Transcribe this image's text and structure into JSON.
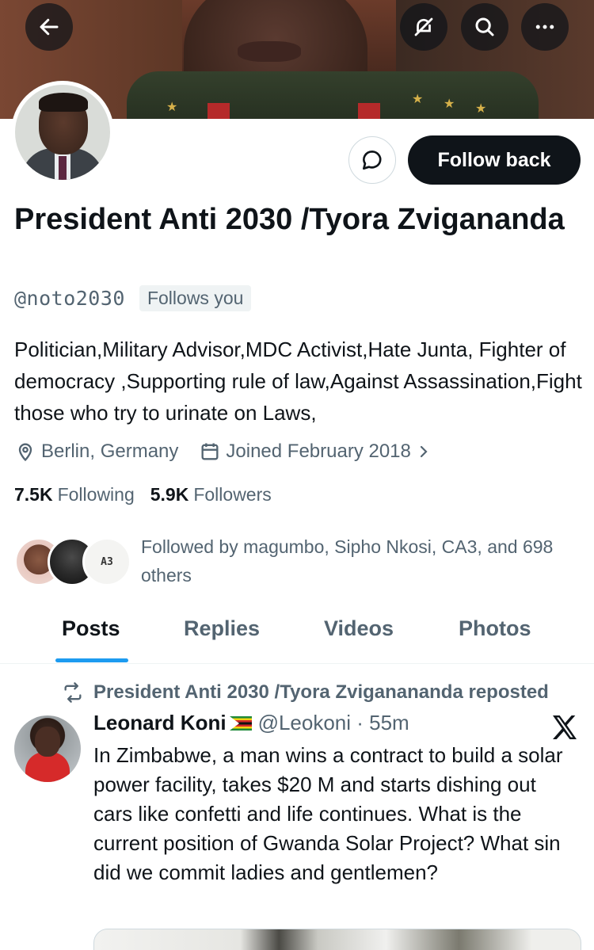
{
  "header": {
    "back_icon": "arrow-left-icon",
    "notifications_off_icon": "bell-slash-icon",
    "search_icon": "search-icon",
    "more_icon": "more-horizontal-icon"
  },
  "profile": {
    "name": "President Anti 2030 /Tyora Zvigananda",
    "handle": "@noto2030",
    "follows_you": "Follows you",
    "bio": "Politician,Military Advisor,MDC Activist,Hate Junta, Fighter of democracy ,Supporting rule of law,Against Assassination,Fight those who try to urinate on Laws,",
    "location": "Berlin, Germany",
    "joined": "Joined February 2018",
    "following_count": "7.5K",
    "following_label": "Following",
    "followers_count": "5.9K",
    "followers_label": "Followers",
    "followed_by": "Followed by magumbo, Sipho Nkosi, CA3, and 698 others",
    "mini_avatar_c_text": "A3"
  },
  "actions": {
    "message_icon": "message-bubble-icon",
    "follow_back_label": "Follow back"
  },
  "tabs": [
    {
      "label": "Posts",
      "active": true
    },
    {
      "label": "Replies",
      "active": false
    },
    {
      "label": "Videos",
      "active": false
    },
    {
      "label": "Photos",
      "active": false
    }
  ],
  "post": {
    "repost_text": "President Anti 2030 /Tyora Zviganananda reposted",
    "author": "Leonard Koni",
    "handle_time": "@Leokoni · 55m",
    "text": "In Zimbabwe, a man wins a contract to build a solar power facility, takes $20 M and starts dishing out cars like confetti and life continues. What is the current position of Gwanda Solar Project? What sin did we commit ladies and gentlemen?"
  },
  "colors": {
    "accent": "#1d9bf0",
    "text_primary": "#0f1419",
    "text_secondary": "#536471",
    "button_dark": "#0f1419"
  }
}
